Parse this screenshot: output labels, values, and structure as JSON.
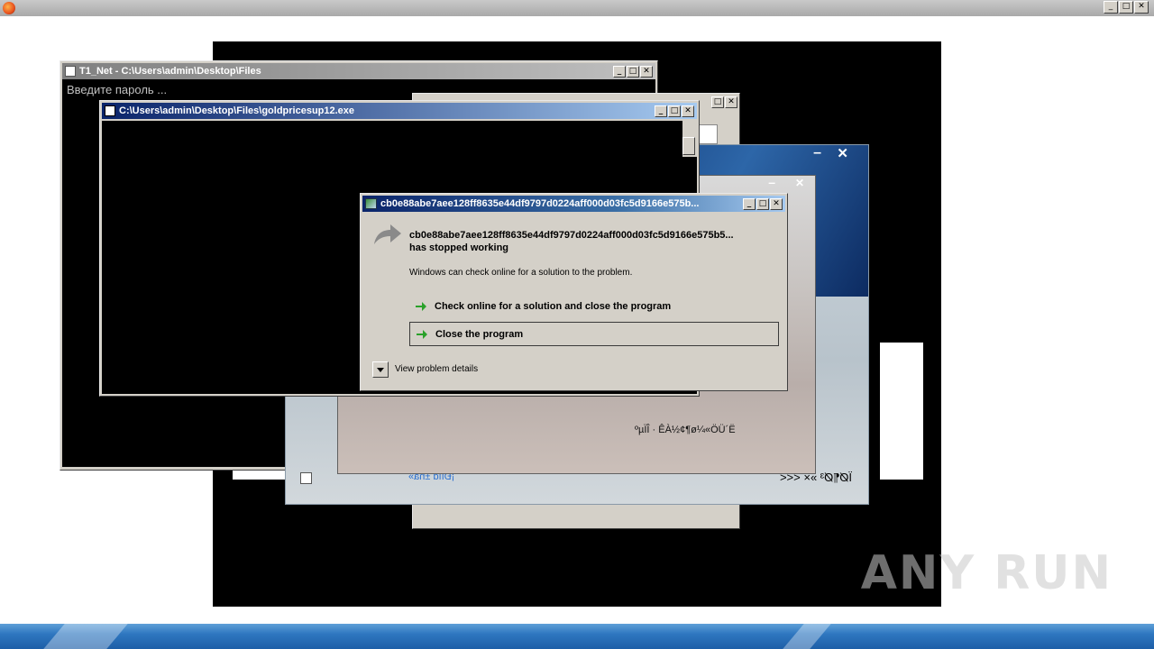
{
  "outer_window": {
    "controls": [
      "_",
      "□",
      "✕"
    ]
  },
  "console_window": {
    "title": "T1_Net - C:\\Users\\admin\\Desktop\\Files",
    "prompt_text": "Введите пароль ..."
  },
  "exe_window": {
    "title": "C:\\Users\\admin\\Desktop\\Files\\goldpricesup12.exe"
  },
  "blue_window": {
    "minimize": "–",
    "close": "✕"
  },
  "photo_window": {
    "garbled_label": "ºµÏÎ · ÊÀ½¢¶ø¼«ÖÜ´Ë",
    "mirrored_link": "¡Ðìíd ±ñà»",
    "nav_text": "ÏØ¶Ø³ »× <<<",
    "close": "✕",
    "minimize": "–"
  },
  "error_dialog": {
    "title": "cb0e88abe7aee128ff8635e44df9797d0224aff000d03fc5d9166e575b...",
    "heading_line1": "cb0e88abe7aee128ff8635e44df9797d0224aff000d03fc5d9166e575b5...",
    "heading_line2": "has stopped working",
    "message": "Windows can check online for a solution to the problem.",
    "option_check_online": "Check online for a solution and close the program",
    "option_close": "Close the program",
    "details_label": "View problem details"
  },
  "watermark": {
    "text": "ANY RUN"
  },
  "colors": {
    "title_active": "#0a246a",
    "title_gradient_end": "#a6caf0",
    "classic_face": "#d4d0c8",
    "taskbar": "#2f77c0",
    "console_bg": "#000000",
    "arrow_green": "#2aa12a"
  }
}
